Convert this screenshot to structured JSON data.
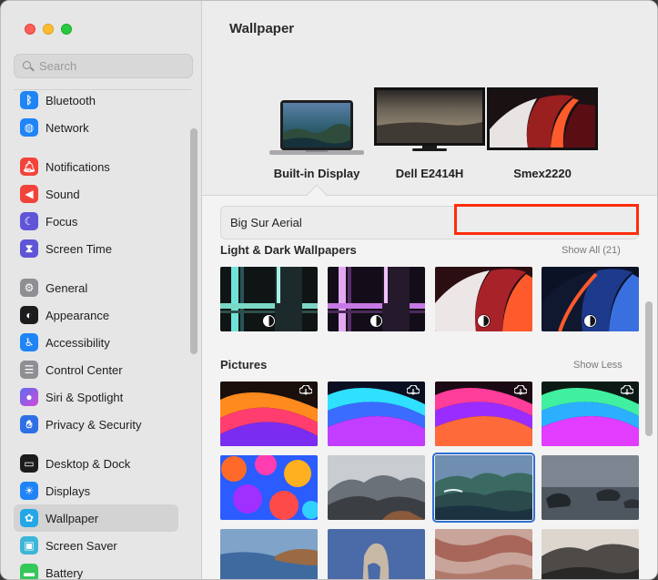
{
  "window": {
    "title": "Wallpaper"
  },
  "search": {
    "placeholder": "Search"
  },
  "sidebar": {
    "items": [
      {
        "label": "Bluetooth",
        "icon": "bluetooth-icon",
        "color": "#1f84f5"
      },
      {
        "label": "Network",
        "icon": "globe-icon",
        "color": "#1f84f5"
      },
      {
        "label": "Notifications",
        "icon": "bell-icon",
        "color": "#f2433a"
      },
      {
        "label": "Sound",
        "icon": "speaker-icon",
        "color": "#f2433a"
      },
      {
        "label": "Focus",
        "icon": "moon-icon",
        "color": "#5f55d6"
      },
      {
        "label": "Screen Time",
        "icon": "hourglass-icon",
        "color": "#5f55d6"
      },
      {
        "label": "General",
        "icon": "gear-icon",
        "color": "#8e8e93"
      },
      {
        "label": "Appearance",
        "icon": "appearance-icon",
        "color": "#1c1c1e"
      },
      {
        "label": "Accessibility",
        "icon": "accessibility-icon",
        "color": "#1f84f5"
      },
      {
        "label": "Control Center",
        "icon": "toggles-icon",
        "color": "#8e8e93"
      },
      {
        "label": "Siri & Spotlight",
        "icon": "siri-icon",
        "color": "#a94de0"
      },
      {
        "label": "Privacy & Security",
        "icon": "hand-icon",
        "color": "#2f6fe6"
      },
      {
        "label": "Desktop & Dock",
        "icon": "dock-icon",
        "color": "#1c1c1e"
      },
      {
        "label": "Displays",
        "icon": "sun-icon",
        "color": "#1f84f5"
      },
      {
        "label": "Wallpaper",
        "icon": "flower-icon",
        "color": "#23a7e6",
        "selected": true
      },
      {
        "label": "Screen Saver",
        "icon": "screensaver-icon",
        "color": "#3bb6d8"
      },
      {
        "label": "Battery",
        "icon": "battery-icon",
        "color": "#34c759"
      }
    ]
  },
  "displays": [
    {
      "label": "Built-in Display",
      "selected": true
    },
    {
      "label": "Dell E2414H"
    },
    {
      "label": "Smex2220"
    }
  ],
  "wallpaper_field": {
    "value": "Big Sur Aerial"
  },
  "sections": {
    "light_dark": {
      "heading": "Light & Dark Wallpapers",
      "link": "Show All (21)"
    },
    "pictures": {
      "heading": "Pictures",
      "link": "Show Less"
    }
  },
  "thumbnails": {
    "light_dark": [
      "macbook-pro-green-icon",
      "macbook-pro-purple-icon",
      "ventura-red-icon",
      "ventura-blue-icon"
    ],
    "pictures_row1": [
      "macbook-pro-orange",
      "macbook-pro-blue",
      "macbook-pro-pink",
      "macbook-pro-green"
    ],
    "pictures_row2": [
      "monterey-abstract",
      "mountain-mist",
      "big-sur-coast",
      "rocky-shore"
    ],
    "pictures_row3": [
      "coast-blue",
      "rock-arch",
      "canyon-red",
      "valley-dusk"
    ]
  },
  "colors": {
    "accent": "#2f6fd6",
    "highlight": "#ff2d0c"
  }
}
